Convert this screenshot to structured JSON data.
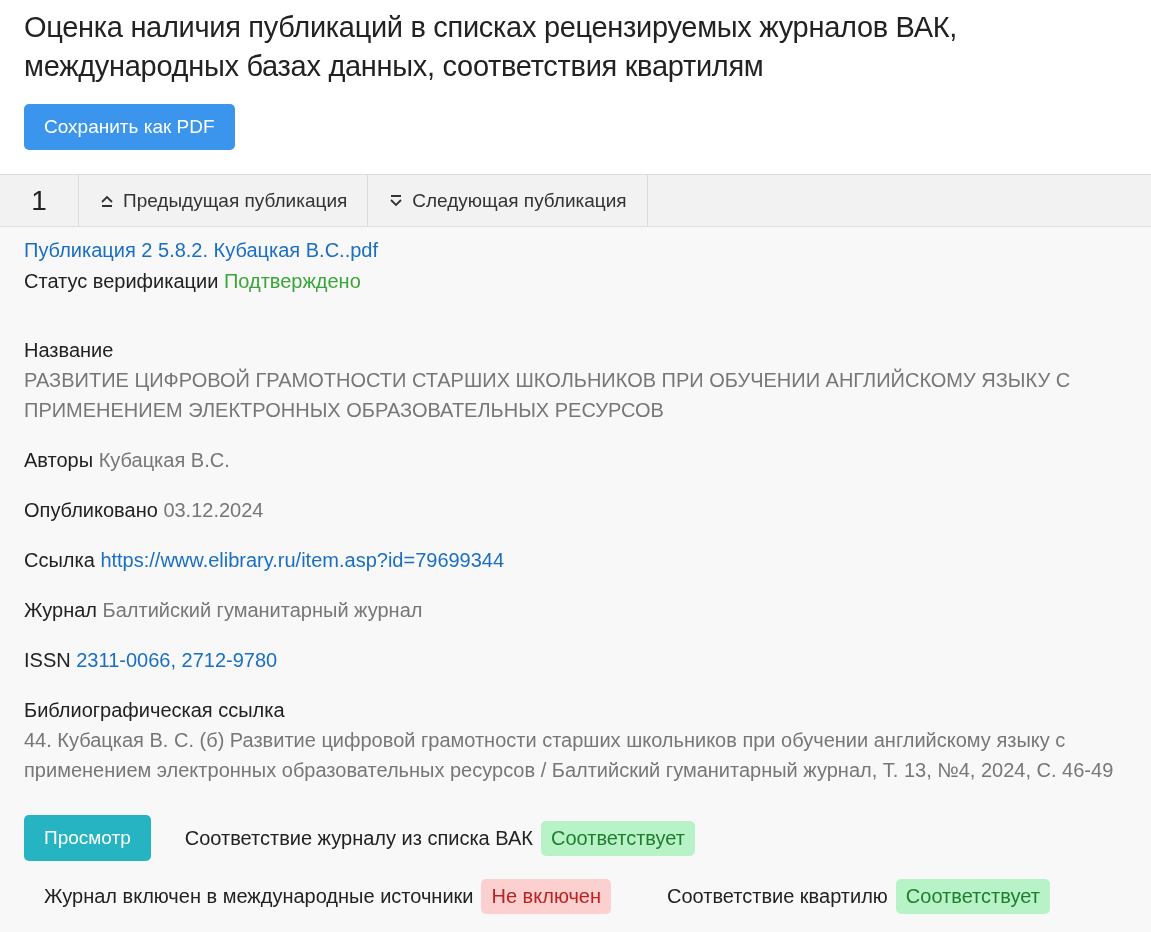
{
  "title": "Оценка наличия публикаций в списках рецензируемых журналов ВАК, международных базах данных, соответствия квартилям",
  "save_button": "Сохранить как PDF",
  "nav": {
    "number": "1",
    "prev": "Предыдущая публикация",
    "next": "Следующая публикация"
  },
  "file_link": "Публикация 2 5.8.2. Кубацкая В.С..pdf",
  "status": {
    "label": "Статус верификации",
    "value": "Подтверждено",
    "kind": "ok"
  },
  "fields": [
    {
      "kind": "block",
      "label": "Название",
      "values": [
        "РАЗВИТИЕ ЦИФРОВОЙ ГРАМОТНОСТИ СТАРШИХ ШКОЛЬНИКОВ ПРИ ОБУЧЕНИИ АНГЛИЙСКОМУ ЯЗЫКУ С ПРИМЕНЕНИЕМ ЭЛЕКТРОННЫХ ОБРАЗОВАТЕЛЬНЫХ РЕСУРСОВ"
      ],
      "links": false
    },
    {
      "kind": "inline",
      "label": "Авторы",
      "values": [
        "Кубацкая В.С."
      ],
      "links": false
    },
    {
      "kind": "inline",
      "label": "Опубликовано",
      "values": [
        "03.12.2024"
      ],
      "links": false
    },
    {
      "kind": "inline",
      "label": "Ссылка",
      "values": [
        "https://www.elibrary.ru/item.asp?id=79699344"
      ],
      "links": true
    },
    {
      "kind": "inline",
      "label": "Журнал",
      "values": [
        "Балтийский гуманитарный журнал"
      ],
      "links": false
    },
    {
      "kind": "inline",
      "label": "ISSN",
      "values": [
        "2311-0066,",
        "2712-9780"
      ],
      "links": true
    },
    {
      "kind": "block",
      "label": "Библиографическая ссылка",
      "values": [
        "44. Кубацкая В. С. (б) Развитие цифровой грамотности старших школьников при обучении английскому языку с применением электронных образовательных ресурсов / Балтийский гуманитарный журнал, Т. 13, №4, 2024, С. 46-49"
      ],
      "links": false
    }
  ],
  "view_button": "Просмотр",
  "checks": [
    {
      "label": "Соответствие журналу из списка ВАК",
      "badge": "Соответствует",
      "kind": "ok"
    },
    {
      "label": "Журнал включен в международные источники",
      "badge": "Не включен",
      "kind": "no"
    },
    {
      "label": "Соответствие квартилю",
      "badge": "Соответствует",
      "kind": "ok"
    }
  ]
}
